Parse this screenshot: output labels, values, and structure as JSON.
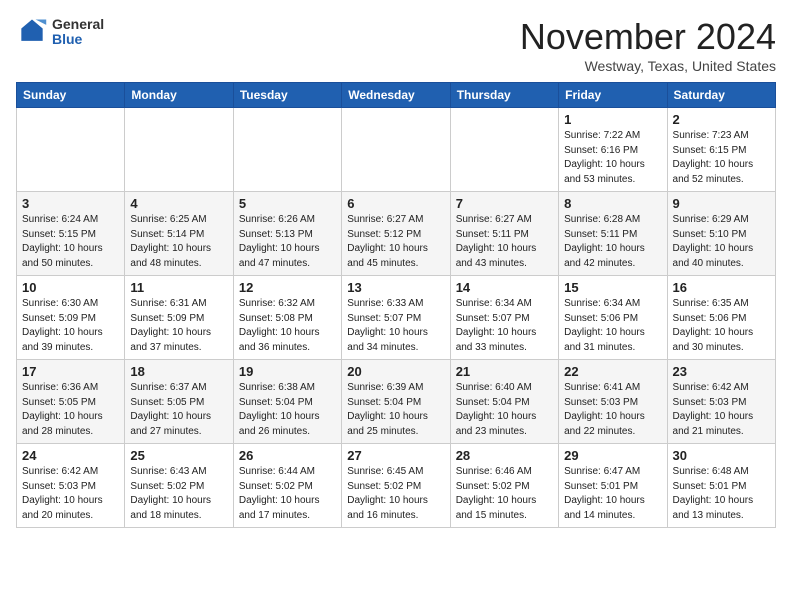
{
  "header": {
    "logo_general": "General",
    "logo_blue": "Blue",
    "month_title": "November 2024",
    "location": "Westway, Texas, United States"
  },
  "weekdays": [
    "Sunday",
    "Monday",
    "Tuesday",
    "Wednesday",
    "Thursday",
    "Friday",
    "Saturday"
  ],
  "weeks": [
    [
      {
        "day": "",
        "info": ""
      },
      {
        "day": "",
        "info": ""
      },
      {
        "day": "",
        "info": ""
      },
      {
        "day": "",
        "info": ""
      },
      {
        "day": "",
        "info": ""
      },
      {
        "day": "1",
        "info": "Sunrise: 7:22 AM\nSunset: 6:16 PM\nDaylight: 10 hours\nand 53 minutes."
      },
      {
        "day": "2",
        "info": "Sunrise: 7:23 AM\nSunset: 6:15 PM\nDaylight: 10 hours\nand 52 minutes."
      }
    ],
    [
      {
        "day": "3",
        "info": "Sunrise: 6:24 AM\nSunset: 5:15 PM\nDaylight: 10 hours\nand 50 minutes."
      },
      {
        "day": "4",
        "info": "Sunrise: 6:25 AM\nSunset: 5:14 PM\nDaylight: 10 hours\nand 48 minutes."
      },
      {
        "day": "5",
        "info": "Sunrise: 6:26 AM\nSunset: 5:13 PM\nDaylight: 10 hours\nand 47 minutes."
      },
      {
        "day": "6",
        "info": "Sunrise: 6:27 AM\nSunset: 5:12 PM\nDaylight: 10 hours\nand 45 minutes."
      },
      {
        "day": "7",
        "info": "Sunrise: 6:27 AM\nSunset: 5:11 PM\nDaylight: 10 hours\nand 43 minutes."
      },
      {
        "day": "8",
        "info": "Sunrise: 6:28 AM\nSunset: 5:11 PM\nDaylight: 10 hours\nand 42 minutes."
      },
      {
        "day": "9",
        "info": "Sunrise: 6:29 AM\nSunset: 5:10 PM\nDaylight: 10 hours\nand 40 minutes."
      }
    ],
    [
      {
        "day": "10",
        "info": "Sunrise: 6:30 AM\nSunset: 5:09 PM\nDaylight: 10 hours\nand 39 minutes."
      },
      {
        "day": "11",
        "info": "Sunrise: 6:31 AM\nSunset: 5:09 PM\nDaylight: 10 hours\nand 37 minutes."
      },
      {
        "day": "12",
        "info": "Sunrise: 6:32 AM\nSunset: 5:08 PM\nDaylight: 10 hours\nand 36 minutes."
      },
      {
        "day": "13",
        "info": "Sunrise: 6:33 AM\nSunset: 5:07 PM\nDaylight: 10 hours\nand 34 minutes."
      },
      {
        "day": "14",
        "info": "Sunrise: 6:34 AM\nSunset: 5:07 PM\nDaylight: 10 hours\nand 33 minutes."
      },
      {
        "day": "15",
        "info": "Sunrise: 6:34 AM\nSunset: 5:06 PM\nDaylight: 10 hours\nand 31 minutes."
      },
      {
        "day": "16",
        "info": "Sunrise: 6:35 AM\nSunset: 5:06 PM\nDaylight: 10 hours\nand 30 minutes."
      }
    ],
    [
      {
        "day": "17",
        "info": "Sunrise: 6:36 AM\nSunset: 5:05 PM\nDaylight: 10 hours\nand 28 minutes."
      },
      {
        "day": "18",
        "info": "Sunrise: 6:37 AM\nSunset: 5:05 PM\nDaylight: 10 hours\nand 27 minutes."
      },
      {
        "day": "19",
        "info": "Sunrise: 6:38 AM\nSunset: 5:04 PM\nDaylight: 10 hours\nand 26 minutes."
      },
      {
        "day": "20",
        "info": "Sunrise: 6:39 AM\nSunset: 5:04 PM\nDaylight: 10 hours\nand 25 minutes."
      },
      {
        "day": "21",
        "info": "Sunrise: 6:40 AM\nSunset: 5:04 PM\nDaylight: 10 hours\nand 23 minutes."
      },
      {
        "day": "22",
        "info": "Sunrise: 6:41 AM\nSunset: 5:03 PM\nDaylight: 10 hours\nand 22 minutes."
      },
      {
        "day": "23",
        "info": "Sunrise: 6:42 AM\nSunset: 5:03 PM\nDaylight: 10 hours\nand 21 minutes."
      }
    ],
    [
      {
        "day": "24",
        "info": "Sunrise: 6:42 AM\nSunset: 5:03 PM\nDaylight: 10 hours\nand 20 minutes."
      },
      {
        "day": "25",
        "info": "Sunrise: 6:43 AM\nSunset: 5:02 PM\nDaylight: 10 hours\nand 18 minutes."
      },
      {
        "day": "26",
        "info": "Sunrise: 6:44 AM\nSunset: 5:02 PM\nDaylight: 10 hours\nand 17 minutes."
      },
      {
        "day": "27",
        "info": "Sunrise: 6:45 AM\nSunset: 5:02 PM\nDaylight: 10 hours\nand 16 minutes."
      },
      {
        "day": "28",
        "info": "Sunrise: 6:46 AM\nSunset: 5:02 PM\nDaylight: 10 hours\nand 15 minutes."
      },
      {
        "day": "29",
        "info": "Sunrise: 6:47 AM\nSunset: 5:01 PM\nDaylight: 10 hours\nand 14 minutes."
      },
      {
        "day": "30",
        "info": "Sunrise: 6:48 AM\nSunset: 5:01 PM\nDaylight: 10 hours\nand 13 minutes."
      }
    ]
  ]
}
